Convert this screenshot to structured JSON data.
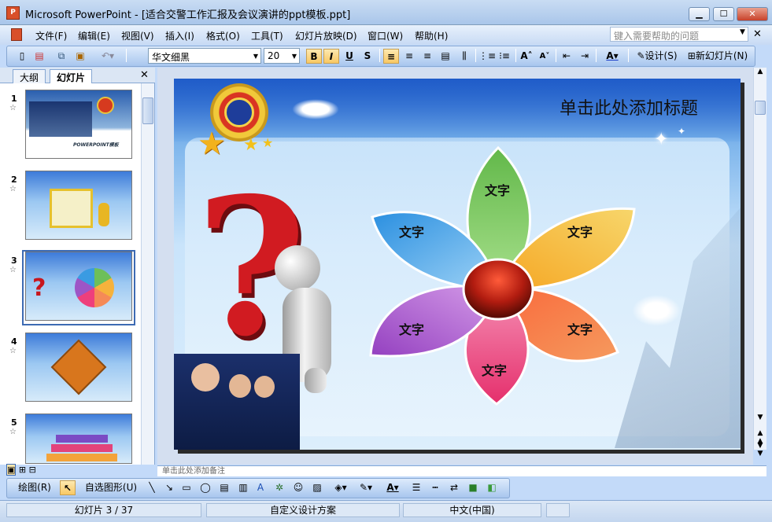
{
  "window": {
    "title": "Microsoft PowerPoint - [适合交警工作汇报及会议演讲的ppt模板.ppt]",
    "app_icon": "P"
  },
  "menu": {
    "items": [
      "文件(F)",
      "编辑(E)",
      "视图(V)",
      "插入(I)",
      "格式(O)",
      "工具(T)",
      "幻灯片放映(D)",
      "窗口(W)",
      "帮助(H)"
    ],
    "help_placeholder": "键入需要帮助的问题"
  },
  "toolbar": {
    "font": "华文细黑",
    "size": "20",
    "bold": "B",
    "italic": "I",
    "underline": "U",
    "shadow": "S",
    "design": "设计(S)",
    "new_slide": "新幻灯片(N)"
  },
  "panel": {
    "tab_outline": "大纲",
    "tab_slides": "幻灯片",
    "thumbnails": [
      {
        "num": "1",
        "caption": "POWERPOINT模板"
      },
      {
        "num": "2"
      },
      {
        "num": "3"
      },
      {
        "num": "4"
      },
      {
        "num": "5"
      }
    ]
  },
  "slide": {
    "title": "单击此处添加标题",
    "petals": [
      "文字",
      "文字",
      "文字",
      "文字",
      "文字",
      "文字"
    ]
  },
  "notes": {
    "placeholder": "单击此处添加备注"
  },
  "drawbar": {
    "draw": "绘图(R)",
    "autoshapes": "自选图形(U)"
  },
  "status": {
    "slide": "幻灯片 3 / 37",
    "design": "自定义设计方案",
    "lang": "中文(中国)"
  },
  "colors": {
    "petal_green": "#6dbf5a",
    "petal_orange": "#f6b23c",
    "petal_salmon": "#f58a57",
    "petal_pink": "#ee3f7c",
    "petal_purple": "#9d55c6",
    "petal_blue": "#3a9be2",
    "center": "#b21c10"
  }
}
